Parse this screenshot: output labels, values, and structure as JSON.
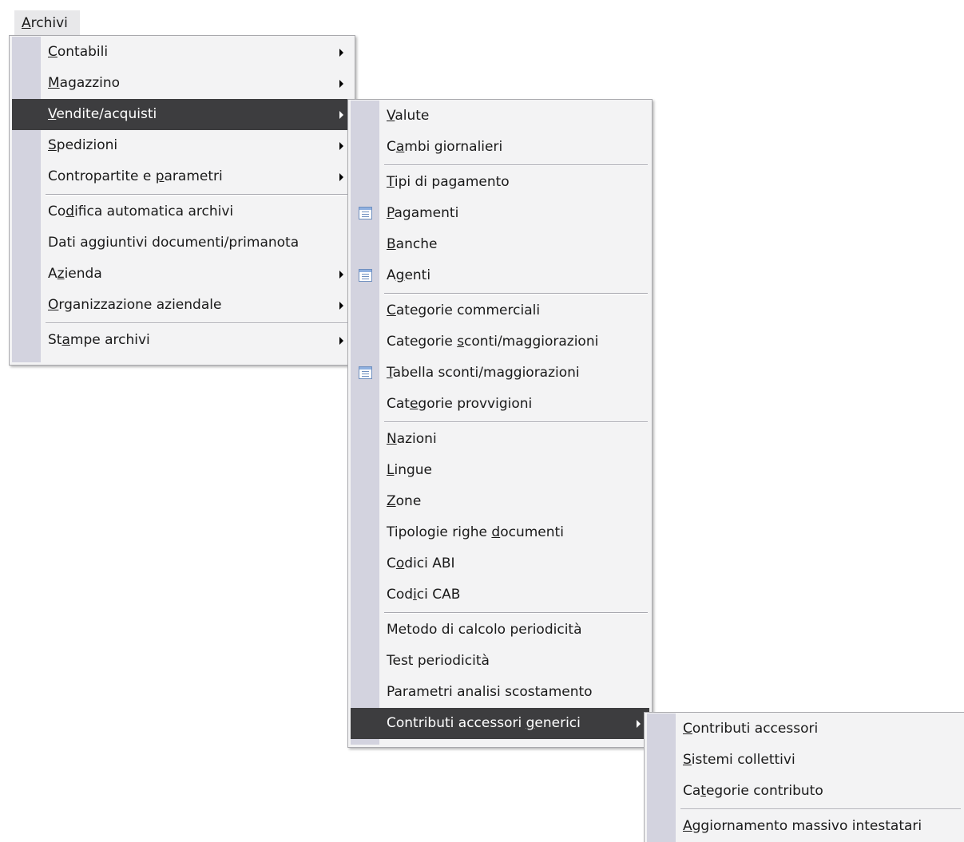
{
  "menubar": {
    "archivi": {
      "pre": "",
      "key": "A",
      "post": "rchivi"
    }
  },
  "archivi_menu": [
    {
      "pre": "",
      "key": "C",
      "post": "ontabili",
      "submenu": true
    },
    {
      "pre": "",
      "key": "M",
      "post": "agazzino",
      "submenu": true
    },
    {
      "pre": "",
      "key": "V",
      "post": "endite/acquisti",
      "submenu": true,
      "highlighted": true
    },
    {
      "pre": "",
      "key": "S",
      "post": "pedizioni",
      "submenu": true
    },
    {
      "pre": "Contropartite e ",
      "key": "p",
      "post": "arametri",
      "submenu": true
    },
    {
      "separator": true
    },
    {
      "pre": "Co",
      "key": "d",
      "post": "ifica automatica archivi"
    },
    {
      "pre": "Dati a",
      "key": "g",
      "post": "giuntivi documenti/primanota"
    },
    {
      "pre": "A",
      "key": "z",
      "post": "ienda",
      "submenu": true
    },
    {
      "pre": "",
      "key": "O",
      "post": "rganizzazione aziendale",
      "submenu": true
    },
    {
      "separator": true
    },
    {
      "pre": "St",
      "key": "a",
      "post": "mpe archivi",
      "submenu": true
    }
  ],
  "vendite_menu": [
    {
      "pre": "",
      "key": "V",
      "post": "alute"
    },
    {
      "pre": "C",
      "key": "a",
      "post": "mbi giornalieri"
    },
    {
      "separator": true
    },
    {
      "pre": "",
      "key": "T",
      "post": "ipi di pagamento"
    },
    {
      "pre": "",
      "key": "P",
      "post": "agamenti",
      "icon": "table-list-icon"
    },
    {
      "pre": "",
      "key": "B",
      "post": "anche"
    },
    {
      "pre": "A",
      "key": "g",
      "post": "enti",
      "icon": "table-list-icon"
    },
    {
      "separator": true
    },
    {
      "pre": "",
      "key": "C",
      "post": "ategorie commerciali"
    },
    {
      "pre": "Categorie ",
      "key": "s",
      "post": "conti/maggiorazioni"
    },
    {
      "pre": "",
      "key": "T",
      "post": "abella sconti/maggiorazioni",
      "icon": "table-list-icon"
    },
    {
      "pre": "Cat",
      "key": "e",
      "post": "gorie provvigioni"
    },
    {
      "separator": true
    },
    {
      "pre": "",
      "key": "N",
      "post": "azioni"
    },
    {
      "pre": "",
      "key": "L",
      "post": "ingue"
    },
    {
      "pre": "",
      "key": "Z",
      "post": "one"
    },
    {
      "pre": "Tipologie righe ",
      "key": "d",
      "post": "ocumenti"
    },
    {
      "pre": "C",
      "key": "o",
      "post": "dici ABI"
    },
    {
      "pre": "Cod",
      "key": "i",
      "post": "ci CAB"
    },
    {
      "separator": true
    },
    {
      "pre": "Metodo di calcolo periodicità",
      "key": "",
      "post": ""
    },
    {
      "pre": "Test periodicità",
      "key": "",
      "post": ""
    },
    {
      "pre": "Parametri analisi scostamento",
      "key": "",
      "post": ""
    },
    {
      "pre": "Contributi accessori ",
      "key": "g",
      "post": "enerici",
      "submenu": true,
      "highlighted": true
    }
  ],
  "contributi_menu": [
    {
      "pre": "",
      "key": "C",
      "post": "ontributi accessori"
    },
    {
      "pre": "",
      "key": "S",
      "post": "istemi collettivi"
    },
    {
      "pre": "Ca",
      "key": "t",
      "post": "egorie contributo"
    },
    {
      "separator": true
    },
    {
      "pre": "",
      "key": "A",
      "post": "ggiornamento massivo intestatari"
    }
  ],
  "colors": {
    "highlight": "#3d3d3f",
    "menu_bg": "#f3f3f4",
    "gutter": "#d3d3df"
  }
}
